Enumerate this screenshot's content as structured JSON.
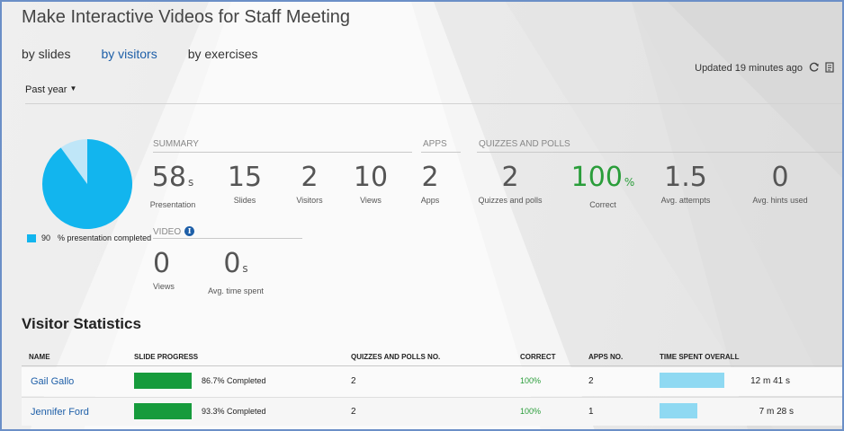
{
  "title": "Make Interactive Videos for Staff Meeting",
  "tabs": [
    {
      "label": "by slides"
    },
    {
      "label": "by visitors"
    },
    {
      "label": "by exercises"
    }
  ],
  "active_tab": "by visitors",
  "updated": "Updated 19 minutes ago",
  "range": "Past year",
  "colors": {
    "accent": "#1e5fa8",
    "pie": "#12b5ee",
    "pie_rest": "#bfe6f8",
    "green": "#2a9d3a",
    "progress_bar": "#169b3c",
    "time_bar": "#8fd9f2"
  },
  "pie": {
    "value": "90",
    "percent_completed": 90,
    "label": "% presentation completed"
  },
  "summary": {
    "header": "SUMMARY",
    "presentation": {
      "value": "58",
      "unit": "s",
      "label": "Presentation"
    },
    "slides": {
      "value": "15",
      "label": "Slides"
    },
    "visitors": {
      "value": "2",
      "label": "Visitors"
    },
    "views": {
      "value": "10",
      "label": "Views"
    }
  },
  "apps": {
    "header": "APPS",
    "value": "2",
    "label": "Apps"
  },
  "quizzes": {
    "header": "QUIZZES AND POLLS",
    "count": {
      "value": "2",
      "label": "Quizzes and polls"
    },
    "correct": {
      "value": "100",
      "unit": "%",
      "label": "Correct"
    },
    "attempts": {
      "value": "1.5",
      "label": "Avg. attempts"
    },
    "hints": {
      "value": "0",
      "label": "Avg. hints used"
    }
  },
  "video": {
    "header": "VIDEO",
    "views": {
      "value": "0",
      "label": "Views"
    },
    "time": {
      "value": "0",
      "unit": "s",
      "label": "Avg. time spent"
    }
  },
  "visitor_statistics": {
    "title": "Visitor Statistics",
    "columns": [
      "NAME",
      "SLIDE PROGRESS",
      "QUIZZES AND POLLS NO.",
      "CORRECT",
      "APPS NO.",
      "TIME SPENT OVERALL"
    ],
    "rows": [
      {
        "name": "Gail Gallo",
        "progress_text": "86.7% Completed",
        "progress": 86.7,
        "quizzes": "2",
        "correct": "100%",
        "apps": "2",
        "time": "12 m 41 s",
        "time_seconds": 761
      },
      {
        "name": "Jennifer Ford",
        "progress_text": "93.3% Completed",
        "progress": 93.3,
        "quizzes": "2",
        "correct": "100%",
        "apps": "1",
        "time": "7 m 28 s",
        "time_seconds": 448
      }
    ]
  },
  "icons": {
    "refresh": "refresh-icon",
    "export": "export-icon",
    "info": "info-icon",
    "caret": "caret-down-icon"
  }
}
